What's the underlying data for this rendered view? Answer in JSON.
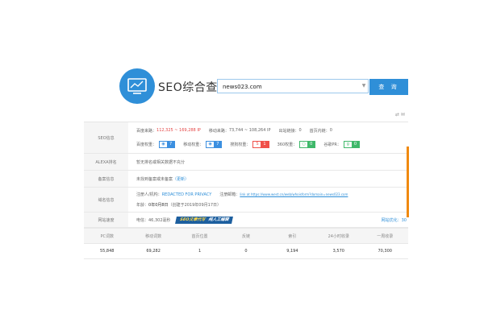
{
  "header": {
    "brand_title": "SEO综合查询",
    "search_value": "news023.com",
    "search_button": "查 询",
    "dropdown_glyph": "▼",
    "corner_glyphs": "⇄ ✉"
  },
  "colors": {
    "accent": "#2f8fd8",
    "red_value": "#e44646",
    "baidu_badge": "#3b8fe0",
    "mobile_badge": "#3b8fe0",
    "sogou_badge": "#f0504a",
    "s360_badge": "#3fb86a",
    "google_badge": "#3fb86a",
    "scroll_strip": "#f08a10"
  },
  "info": {
    "seo": {
      "label": "SEO信息",
      "baidu_source_label": "百度来路：",
      "baidu_source_value": "112,325 ~ 169,288 IP",
      "mobile_source_label": "移动来路：",
      "mobile_source_value": "73,744 ~ 108,264 IP",
      "outbound_label": "出站链接：",
      "outbound_value": "0",
      "home_inner_label": "首页内链：",
      "home_inner_value": "0",
      "baidu_weight_label": "百度权重：",
      "baidu_weight_value": "7",
      "mobile_weight_label": "移动权重：",
      "mobile_weight_value": "7",
      "sogou_weight_label": "搜狗权重：",
      "sogou_weight_value": "1",
      "s360_weight_label": "360权重：",
      "s360_weight_value": "0",
      "google_pr_label": "谷歌PR：",
      "google_pr_value": "0"
    },
    "alexa": {
      "label": "ALEXA排名",
      "text": "暂无排名或相关数据不充分"
    },
    "beian": {
      "label": "备案信息",
      "text": "未找到备案或未备案",
      "update": "（更新）"
    },
    "domain": {
      "label": "域名信息",
      "registrant_label": "注册人/机构：",
      "registrant_value": "REDACTED FOR PRIVACY",
      "email_label": "注册邮箱：",
      "email_value": "link at https://www.west.cn/web/whoisform?domain=news023.com",
      "age_label": "年龄：",
      "age_value": "0年0月8日",
      "created": "（创建于2019年09月17日）"
    },
    "speed": {
      "label": "网站速度",
      "value": "电信：46,302毫秒",
      "ribbon_yellow": "SEO文章代写",
      "ribbon_white": "纯人工编辑",
      "right_link": "网站优化：30"
    }
  },
  "stats": {
    "headers": [
      "PC词数",
      "移动词数",
      "首页位置",
      "反链",
      "索引",
      "24小时收录",
      "一周收录"
    ],
    "values": [
      "55,848",
      "69,282",
      "1",
      "0",
      "9,194",
      "3,570",
      "70,300"
    ]
  }
}
